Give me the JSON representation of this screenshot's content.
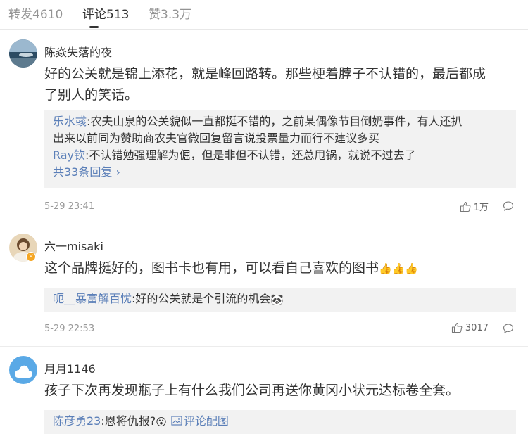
{
  "tabs": [
    {
      "label": "转发4610"
    },
    {
      "label": "评论513"
    },
    {
      "label": "赞3.3万"
    }
  ],
  "comments": [
    {
      "user": "陈焱失落的夜",
      "text_line1": "好的公关就是锦上添花，就是峰回路转。那些梗着脖子不认错的，最后都成",
      "text_line2": "了别人的笑话。",
      "replies": [
        {
          "user": "乐水彧",
          "text_line1": ":农夫山泉的公关貌似一直都挺不错的，之前某偶像节目倒奶事件，有人还扒",
          "text_line2": "出来以前同为赞助商农夫官微回复留言说投票量力而行不建议多买"
        },
        {
          "user": "Ray钦",
          "text": ":不认错勉强理解为倔，但是非但不认错，还总甩锅，就说不过去了"
        }
      ],
      "more": "共33条回复",
      "time": "5-29 23:41",
      "likes": "1万"
    },
    {
      "user": "六一misaki",
      "text": "这个品牌挺好的，图书卡也有用，可以看自己喜欢的图书",
      "emoji": "👍👍👍",
      "replies": [
        {
          "user": "呃__暴富解百忧",
          "text": ":好的公关就是个引流的机会",
          "emoji": "🐼"
        }
      ],
      "time": "5-29 22:53",
      "likes": "3017"
    },
    {
      "user": "月月1146",
      "text": "孩子下次再发现瓶子上有什么我们公司再送你黄冈小状元达标卷全套。",
      "replies": [
        {
          "user": "陈彦勇23",
          "text": ":恩将仇报?",
          "emoji": "😮",
          "link": "评论配图"
        }
      ]
    }
  ]
}
